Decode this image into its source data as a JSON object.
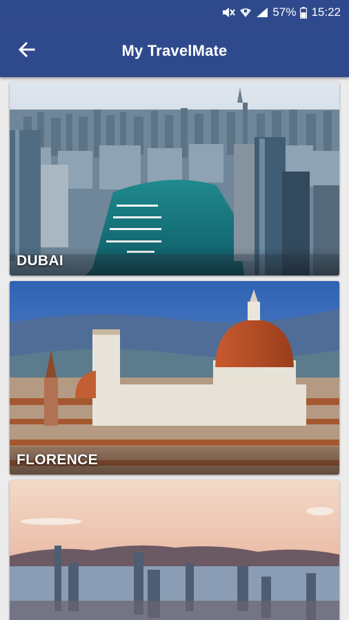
{
  "status_bar": {
    "battery": "57%",
    "time": "15:22",
    "icons": [
      "mute-icon",
      "wifi-icon",
      "signal-icon",
      "battery-icon"
    ]
  },
  "app_bar": {
    "title": "My TravelMate",
    "back_icon": "arrow-back-icon"
  },
  "destinations": [
    {
      "name": "DUBAI"
    },
    {
      "name": "FLORENCE"
    },
    {
      "name": ""
    }
  ],
  "colors": {
    "primary": "#2f4a8c",
    "background": "#ececec"
  }
}
